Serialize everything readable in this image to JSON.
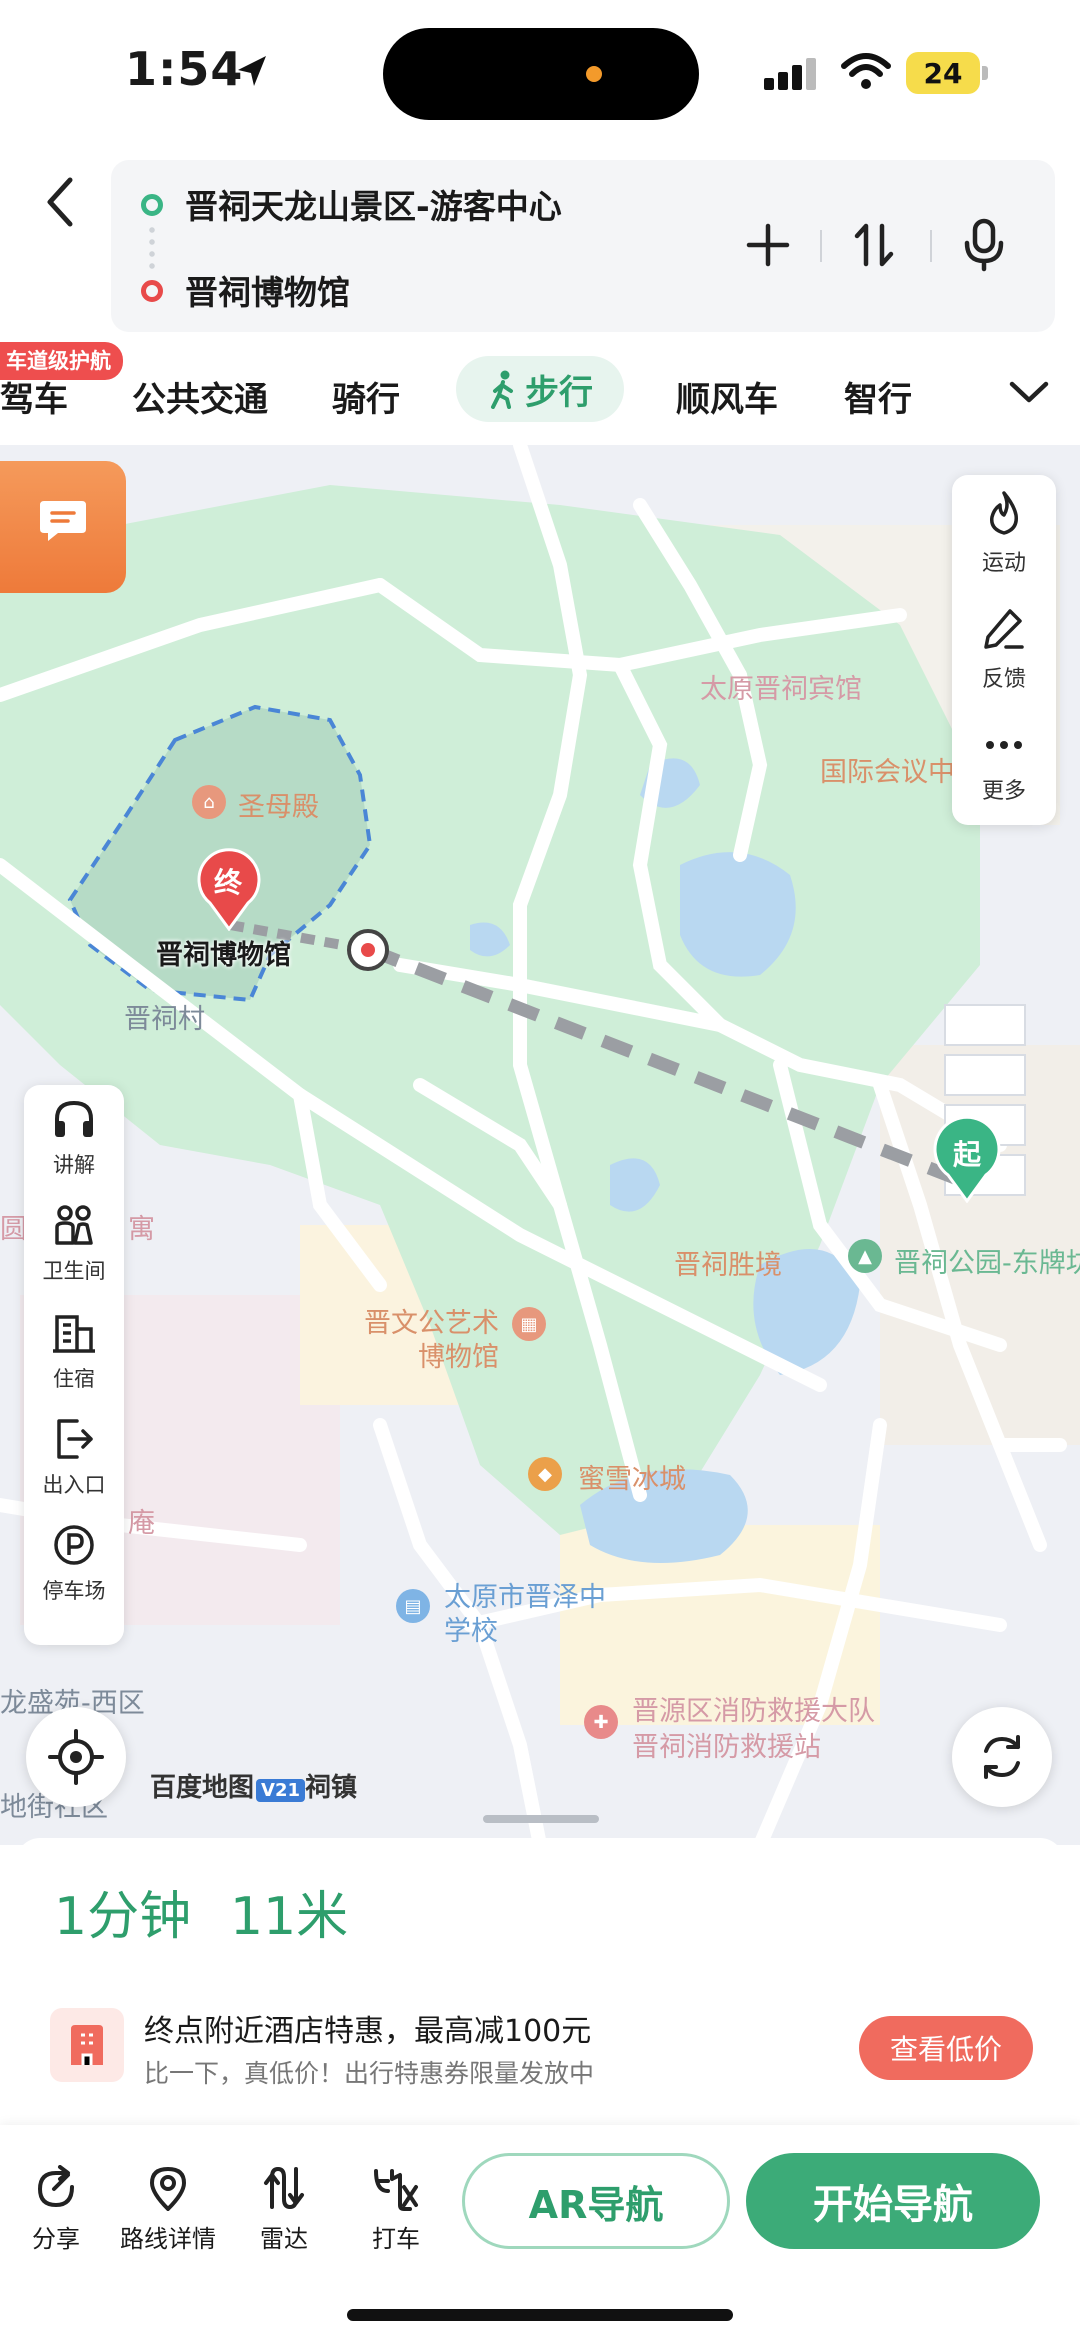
{
  "status_bar": {
    "time": "1:54",
    "battery": "24"
  },
  "route": {
    "from": "晋祠天龙山景区-游客中心",
    "to": "晋祠博物馆"
  },
  "modes": {
    "badge": "车道级护航",
    "items": [
      "驾车",
      "公共交通",
      "骑行",
      "步行",
      "顺风车",
      "智行"
    ],
    "active": "步行"
  },
  "map": {
    "labels": {
      "hotel": "太原晋祠宾馆",
      "conference": "国际会议中",
      "shengmu": "圣母殿",
      "museum": "晋祠博物馆",
      "village": "晋祠村",
      "scenic": "晋祠胜境",
      "park": "晋祠公园-东牌坊",
      "art_museum_1": "晋文公艺术",
      "art_museum_2": "博物馆",
      "mixue": "蜜雪冰城",
      "school_1": "太原市晋泽中",
      "school_2": "学校",
      "fire_1": "晋源区消防救援大队",
      "fire_2": "晋祠消防救援站",
      "longsheng": "龙盛苑-西区",
      "an": "庵",
      "yuan": "圆",
      "yu": "寓",
      "shequ": "地街社区",
      "end_marker": "终",
      "start_marker": "起",
      "baidu_map": "百度地图",
      "scale": "V21",
      "town": "祠镇"
    },
    "right_panel": [
      "运动",
      "反馈",
      "更多"
    ],
    "left_panel": [
      "讲解",
      "卫生间",
      "住宿",
      "出入口",
      "停车场"
    ]
  },
  "summary": {
    "duration": "1分钟",
    "distance": "11米"
  },
  "promo": {
    "title": "终点附近酒店特惠，最高减100元",
    "subtitle": "比一下，真低价！出行特惠券限量发放中",
    "button": "查看低价"
  },
  "bottom_bar": {
    "share": "分享",
    "route_detail": "路线详情",
    "radar": "雷达",
    "taxi": "打车",
    "ar_nav": "AR导航",
    "start_nav": "开始导航"
  },
  "colors": {
    "accent_green": "#2e9e6c",
    "start_button": "#3cab78",
    "promo_button": "#f06b5e",
    "end_marker": "#e84a4a"
  }
}
